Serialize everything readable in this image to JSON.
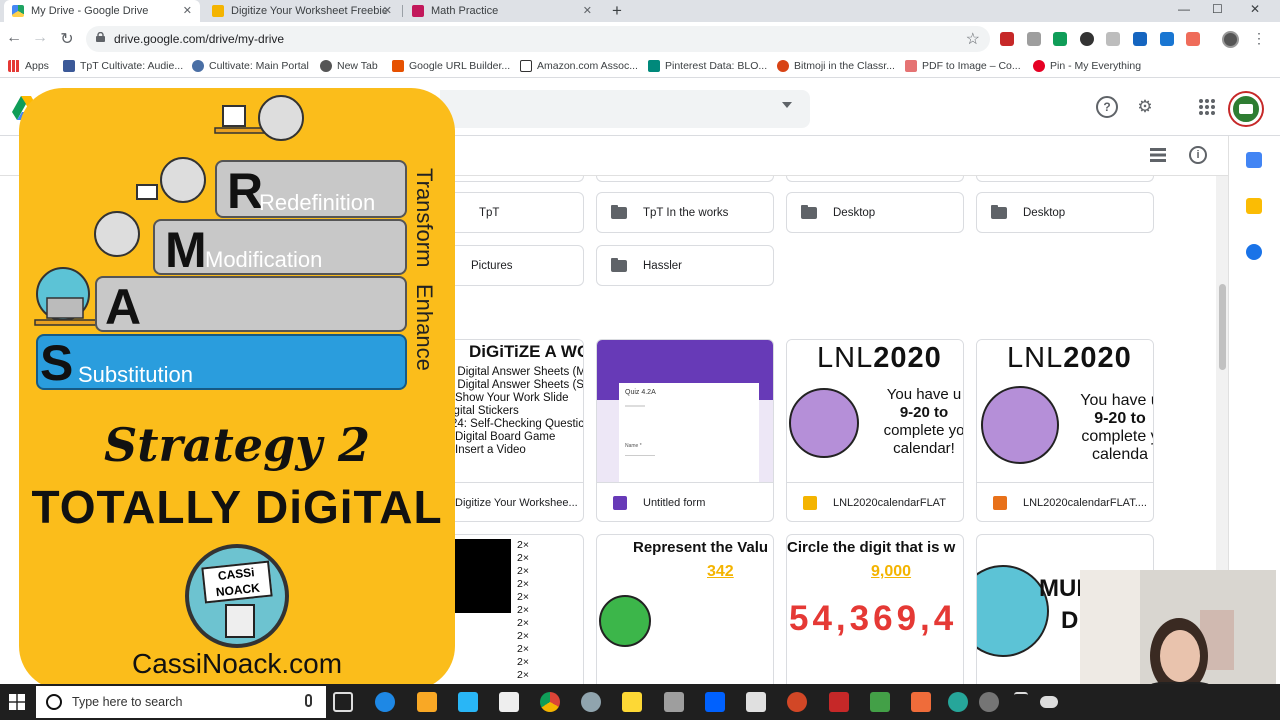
{
  "tabs": [
    {
      "title": "My Drive - Google Drive",
      "close": "✕"
    },
    {
      "title": "Digitize Your Worksheet Freebie",
      "close": "✕"
    },
    {
      "title": "Math Practice",
      "close": "✕"
    }
  ],
  "new_tab": "+",
  "window": {
    "minimize": "—",
    "maximize": "☐",
    "close": "✕"
  },
  "nav": {
    "back": "←",
    "forward": "→",
    "reload": "↻"
  },
  "address": {
    "url": "drive.google.com/drive/my-drive",
    "star": "☆"
  },
  "bookmarks": [
    {
      "label": "Apps"
    },
    {
      "label": "TpT Cultivate: Audie..."
    },
    {
      "label": "Cultivate: Main Portal"
    },
    {
      "label": "New Tab"
    },
    {
      "label": "Google URL Builder..."
    },
    {
      "label": "Amazon.com Assoc..."
    },
    {
      "label": "Pinterest Data: BLO..."
    },
    {
      "label": "Bitmoji in the Classr..."
    },
    {
      "label": "PDF to Image – Co..."
    },
    {
      "label": "Pin - My Everything"
    }
  ],
  "drive": {
    "header_icons": {
      "help": "?",
      "settings": "⚙",
      "apps": "⋮⋮⋮"
    },
    "subbar_icons": {
      "list_view": "☰",
      "info": "i"
    },
    "folders_row1": [
      {
        "label": "TpT"
      },
      {
        "label": "TpT In the works"
      },
      {
        "label": "Desktop"
      },
      {
        "label": "Desktop"
      }
    ],
    "folders_row2": [
      {
        "label": "Pictures"
      },
      {
        "label": "Hassler"
      }
    ],
    "files_row1": [
      {
        "name": "Digitize Your Workshee...",
        "thumb_title": "DiGiTiZE A WORK",
        "thumb_lines": [
          ": Digital Answer Sheets (M",
          ": Digital Answer Sheets (S",
          "Show Your Work Slide",
          "igital Stickers",
          "24: Self-Checking Questic",
          "Digital Board Game",
          "Insert a Video"
        ]
      },
      {
        "name": "Untitled form",
        "thumb_title": "Quiz 4.2A",
        "thumb_field": "Name *"
      },
      {
        "name": "LNL2020calendarFLAT",
        "thumb_title_a": "LNL",
        "thumb_title_b": "2020",
        "thumb_text": [
          "You have u",
          "9-20 to",
          "complete yo",
          "calendar!"
        ]
      },
      {
        "name": "LNL2020calendarFLAT....",
        "thumb_title_a": "LNL",
        "thumb_title_b": "2020",
        "thumb_text": [
          "You have u",
          "9-20 to",
          "complete y",
          "calenda"
        ]
      }
    ],
    "files_row2": [
      {
        "multipliers": [
          "2×",
          "2×",
          "2×",
          "2×",
          "2×",
          "2×",
          "2×",
          "2×",
          "2×",
          "2×",
          "2×"
        ]
      },
      {
        "title": "Represent the Valu",
        "number": "342"
      },
      {
        "title": "Circle the digit that is w",
        "number": "9,000",
        "digits": "54,369,4"
      },
      {
        "title": "MUL",
        "subtitle": "DI"
      }
    ]
  },
  "poster": {
    "steps": [
      {
        "letter": "R",
        "word": "Redefinition"
      },
      {
        "letter": "M",
        "word": "Modification"
      },
      {
        "letter": "A",
        "word": ""
      },
      {
        "letter": "S",
        "word": "Substitution"
      }
    ],
    "side_transform": "Transform",
    "side_enhance": "Enhance",
    "strategy": "Strategy 2",
    "totally": "TOTALLY DiGiTAL",
    "badge_line1": "CASSi",
    "badge_line2": "NOACK",
    "site": "CassiNoack.com"
  },
  "taskbar": {
    "search_placeholder": "Type here to search"
  },
  "colors": {
    "accent_yellow": "#fbbd1b",
    "substitution_blue": "#2a9ddd",
    "chrome_gray": "#dee1e6"
  }
}
